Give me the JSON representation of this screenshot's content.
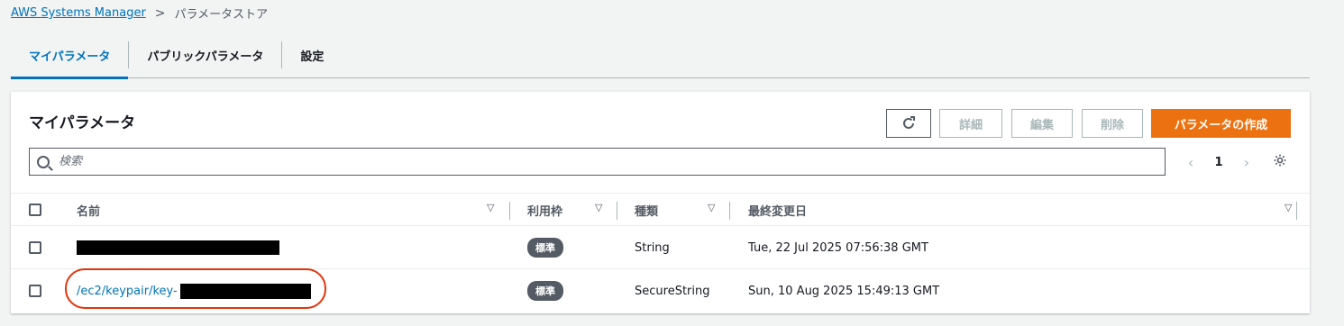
{
  "breadcrumb": {
    "root": "AWS Systems Manager",
    "separator": ">",
    "current": "パラメータストア"
  },
  "tabs": [
    {
      "label": "マイパラメータ",
      "active": true
    },
    {
      "label": "パブリックパラメータ",
      "active": false
    },
    {
      "label": "設定",
      "active": false
    }
  ],
  "panel": {
    "title": "マイパラメータ",
    "buttons": {
      "refresh_icon": "refresh-icon",
      "detail": "詳細",
      "edit": "編集",
      "delete": "削除",
      "create": "パラメータの作成"
    },
    "search": {
      "placeholder": "検索",
      "value": ""
    },
    "pagination": {
      "prev": "‹",
      "page": "1",
      "next": "›"
    },
    "settings_icon": "gear-icon"
  },
  "table": {
    "columns": [
      "名前",
      "利用枠",
      "種類",
      "最終変更日"
    ],
    "rows": [
      {
        "name": "",
        "tier": "標準",
        "type": "String",
        "modified": "Tue, 22 Jul 2025 07:56:38 GMT"
      },
      {
        "name": "/ec2/keypair/key-",
        "tier": "標準",
        "type": "SecureString",
        "modified": "Sun, 10 Aug 2025 15:49:13 GMT"
      }
    ]
  },
  "colors": {
    "accent": "#0073bb",
    "primary_button": "#ec7211",
    "highlight": "#e2350c"
  }
}
